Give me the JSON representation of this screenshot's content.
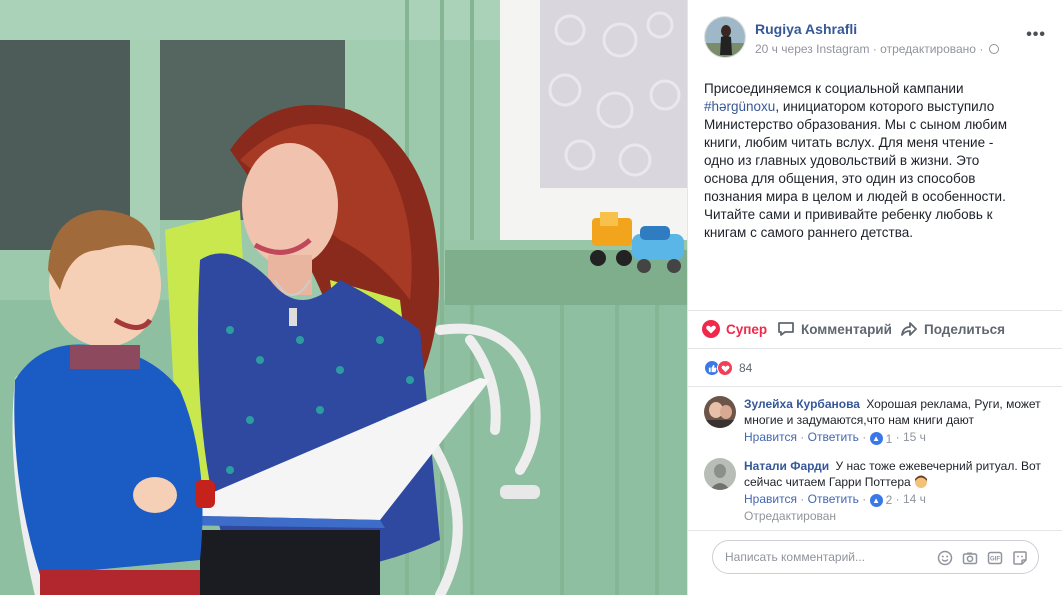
{
  "post": {
    "author": "Rugiya Ashrafli",
    "meta_time": "20 ч",
    "meta_via": "через Instagram",
    "meta_edited": "отредактировано",
    "meta_sep": "·",
    "more_label": "•••",
    "text_before_hashtag": "Присоединяемся к социальной кампании",
    "hashtag": "#hərgünoxu",
    "text_after_hashtag": ", инициатором которого выступило Министерство образования. Мы с сыном любим книги, любим читать вслух. Для меня чтение - одно из главных удовольствий в жизни. Это основа для общения, это один из способов познания мира в целом и людей в особенности. Читайте сами и прививайте ребенку любовь к книгам с самого раннего детства."
  },
  "actions": {
    "like_label": "Супер",
    "comment_label": "Комментарий",
    "share_label": "Поделиться"
  },
  "reactions": {
    "count": "84"
  },
  "comments": [
    {
      "author": "Зулейха Курбанова",
      "text": "Хорошая реклама, Руги, может многие и задумаются,что нам книги дают",
      "like_label": "Нравится",
      "reply_label": "Ответить",
      "likes": "1",
      "time": "15 ч",
      "edited": ""
    },
    {
      "author": "Натали Фарди",
      "text": "У нас тоже ежевечерний ритуал. Вот сейчас читаем Гарри Поттера",
      "like_label": "Нравится",
      "reply_label": "Ответить",
      "likes": "2",
      "time": "14 ч",
      "edited": "Отредактирован"
    }
  ],
  "composer": {
    "placeholder": "Написать комментарий..."
  },
  "colors": {
    "link": "#365899",
    "love": "#f0284a",
    "like": "#3b78e7",
    "muted": "#90949c"
  }
}
